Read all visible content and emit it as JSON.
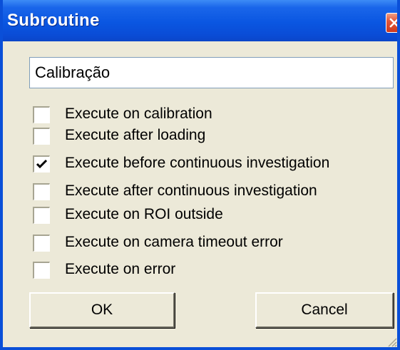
{
  "window": {
    "title": "Subroutine"
  },
  "name_field": {
    "value": "Calibração"
  },
  "options": [
    {
      "label": "Execute on calibration",
      "checked": false
    },
    {
      "label": "Execute after loading",
      "checked": false
    },
    {
      "label": "Execute before continuous investigation",
      "checked": true
    },
    {
      "label": "Execute after continuous investigation",
      "checked": false
    },
    {
      "label": "Execute on ROI outside",
      "checked": false
    },
    {
      "label": "Execute on camera timeout error",
      "checked": false
    },
    {
      "label": "Execute on error",
      "checked": false
    }
  ],
  "buttons": {
    "ok_label": "OK",
    "cancel_label": "Cancel"
  },
  "icons": {
    "close": "close-icon",
    "check": "checkmark-icon",
    "resize": "resize-grip-icon"
  },
  "colors": {
    "titlebar": "#0a56e1",
    "close_button": "#e2563a",
    "dialog_face": "#ece9d8"
  }
}
